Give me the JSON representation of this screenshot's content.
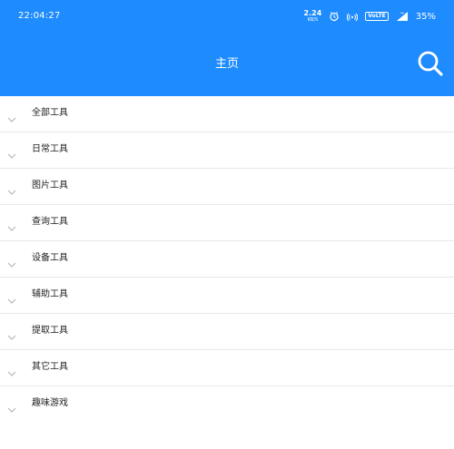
{
  "status_bar": {
    "time": "22:04:27",
    "network_speed_value": "2.24",
    "network_speed_unit": "KB/S",
    "volte_label": "VoLTE",
    "battery_percent": "35%"
  },
  "header": {
    "title": "主页",
    "search_icon": "search-icon",
    "background_color": "#1e8bff"
  },
  "categories": [
    {
      "label": "全部工具"
    },
    {
      "label": "日常工具"
    },
    {
      "label": "图片工具"
    },
    {
      "label": "查询工具"
    },
    {
      "label": "设备工具"
    },
    {
      "label": "辅助工具"
    },
    {
      "label": "提取工具"
    },
    {
      "label": "其它工具"
    },
    {
      "label": "趣味游戏"
    }
  ]
}
